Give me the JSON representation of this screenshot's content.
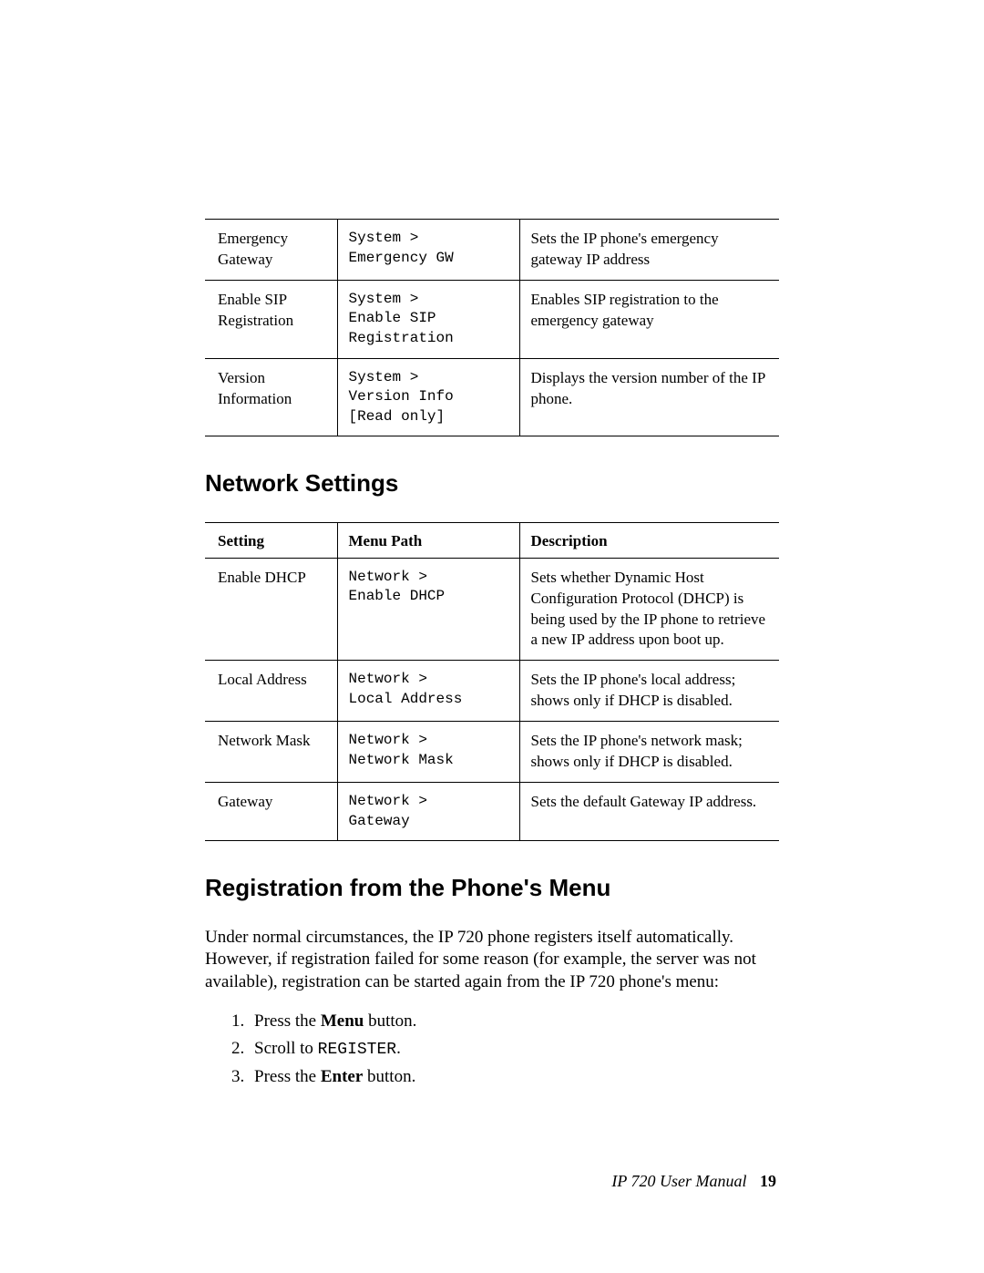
{
  "table1": {
    "rows": [
      {
        "setting": "Emergency Gateway",
        "path": "System >\nEmergency GW",
        "desc": "Sets the IP phone's emergency gateway IP address"
      },
      {
        "setting": "Enable SIP Registration",
        "path": "System >\nEnable SIP\nRegistration",
        "desc": "Enables SIP registration to the emergency gateway"
      },
      {
        "setting": "Version Information",
        "path": "System >\nVersion Info\n[Read only]",
        "desc": "Displays the version number of the IP phone."
      }
    ]
  },
  "heading_network": "Network Settings",
  "table2": {
    "headers": {
      "setting": "Setting",
      "path": "Menu Path",
      "desc": "Description"
    },
    "rows": [
      {
        "setting": "Enable DHCP",
        "path": "Network >\nEnable DHCP",
        "desc": "Sets whether Dynamic Host Configuration Protocol (DHCP) is being used by the IP phone to retrieve a new IP address upon boot up."
      },
      {
        "setting": "Local Address",
        "path": "Network >\nLocal Address",
        "desc": "Sets the IP phone's local address; shows only if DHCP is disabled."
      },
      {
        "setting": "Network Mask",
        "path": "Network >\nNetwork Mask",
        "desc": "Sets the IP phone's network mask; shows only if DHCP is disabled."
      },
      {
        "setting": "Gateway",
        "path": "Network >\nGateway",
        "desc": "Sets the default Gateway IP address."
      }
    ]
  },
  "heading_registration": "Registration from the Phone's Menu",
  "registration_paragraph": "Under normal circumstances, the IP 720 phone registers itself automatically. However, if registration failed for some reason (for example, the server was not available), registration can be started again from the IP 720 phone's menu:",
  "steps": {
    "s1a": "Press the ",
    "s1b": "Menu",
    "s1c": " button.",
    "s2a": "Scroll to ",
    "s2b": "REGISTER",
    "s2c": ".",
    "s3a": "Press the ",
    "s3b": "Enter",
    "s3c": " button."
  },
  "footer": {
    "title": "IP 720 User Manual",
    "page": "19"
  }
}
